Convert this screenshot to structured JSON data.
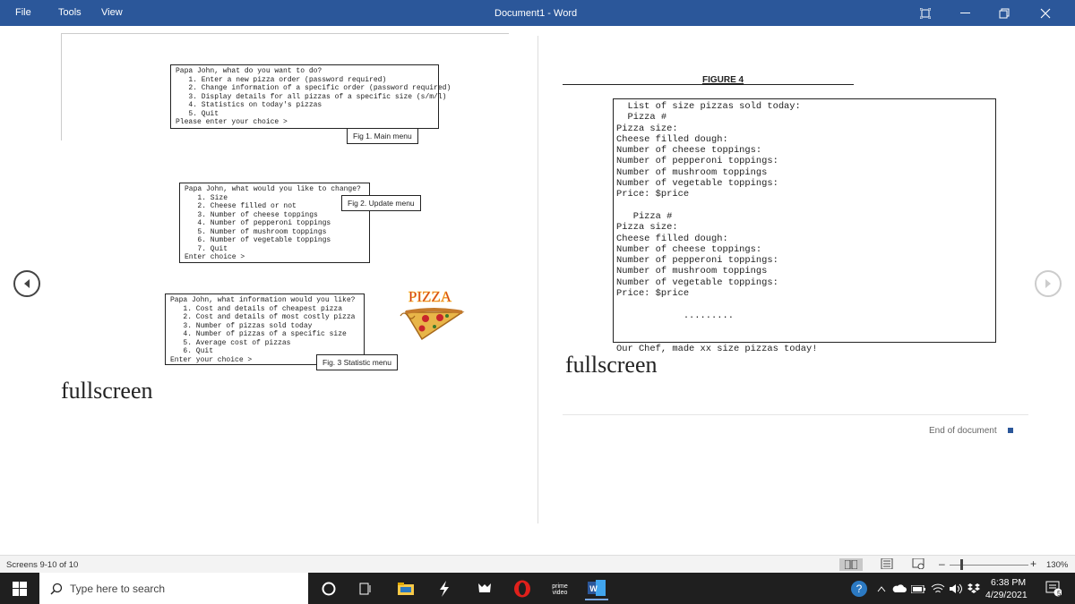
{
  "titlebar": {
    "menu": [
      "File",
      "Tools",
      "View"
    ],
    "document_title": "Document1  -  Word"
  },
  "left_page": {
    "main_menu": {
      "lines": [
        "Papa John, what do you want to do?",
        "   1. Enter a new pizza order (password required)",
        "   2. Change information of a specific order (password required)",
        "   3. Display details for all pizzas of a specific size (s/m/l)",
        "   4. Statistics on today's pizzas",
        "   5. Quit",
        "Please enter your choice >"
      ],
      "caption": "Fig 1. Main menu"
    },
    "update_menu": {
      "lines": [
        "Papa John, what would you like to change?",
        "   1. Size",
        "   2. Cheese filled or not",
        "   3. Number of cheese toppings",
        "   4. Number of pepperoni toppings",
        "   5. Number of mushroom toppings",
        "   6. Number of vegetable toppings",
        "   7. Quit",
        "Enter choice >"
      ],
      "caption": "Fig 2. Update menu"
    },
    "statistic_menu": {
      "lines": [
        "Papa John, what information would you like?",
        "   1. Cost and details of cheapest pizza",
        "   2. Cost and details of most costly pizza",
        "   3. Number of pizzas sold today",
        "   4. Number of pizzas of a specific size",
        "   5. Average cost of pizzas",
        "   6. Quit",
        "Enter your choice >"
      ],
      "caption": "Fig. 3 Statistic menu"
    },
    "pizza_logo_text": "PIZZA",
    "fullscreen": "fullscreen"
  },
  "right_page": {
    "figure_title": "FIGURE 4",
    "lines": [
      "  List of size pizzas sold today:",
      "  Pizza #",
      "Pizza size:",
      "Cheese filled dough:",
      "Number of cheese toppings:",
      "Number of pepperoni toppings:",
      "Number of mushroom toppings",
      "Number of vegetable toppings:",
      "Price: $price",
      "",
      "   Pizza #",
      "Pizza size:",
      "Cheese filled dough:",
      "Number of cheese toppings:",
      "Number of pepperoni toppings:",
      "Number of mushroom toppings",
      "Number of vegetable toppings:",
      "Price: $price",
      "",
      "            .........",
      "",
      "",
      "Our Chef, made xx size pizzas today!"
    ],
    "fullscreen": "fullscreen",
    "end_of_document": "End of document"
  },
  "statusbar": {
    "screens": "Screens 9-10 of 10",
    "zoom": "130%"
  },
  "taskbar": {
    "search_placeholder": "Type here to search",
    "time": "6:38 PM",
    "date": "4/29/2021",
    "notification_count": "5"
  },
  "colors": {
    "titlebar": "#2b579a",
    "taskbar": "#1f1f1f"
  }
}
